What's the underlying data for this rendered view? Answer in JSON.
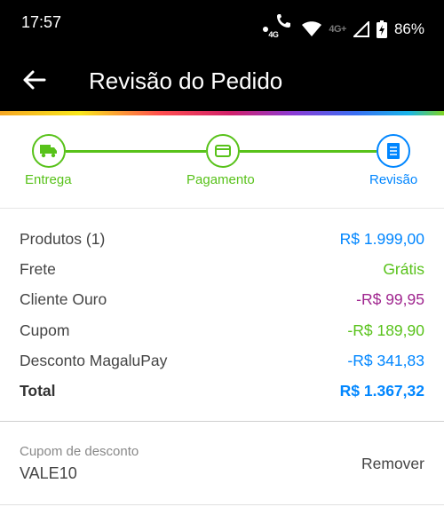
{
  "status_bar": {
    "time": "17:57",
    "net_active": "4G",
    "net_secondary": "4G+",
    "battery": "86%",
    "icons": [
      "dot-icon",
      "wifi-call-icon",
      "wifi-icon",
      "signal-icon",
      "battery-charging-icon"
    ]
  },
  "app_bar": {
    "title": "Revisão do Pedido",
    "back_icon": "arrow-left-icon"
  },
  "stepper": {
    "steps": [
      {
        "label": "Entrega",
        "icon": "truck-icon",
        "state": "done"
      },
      {
        "label": "Pagamento",
        "icon": "credit-card-icon",
        "state": "done"
      },
      {
        "label": "Revisão",
        "icon": "receipt-icon",
        "state": "active"
      }
    ],
    "colors": {
      "done": "#58c21a",
      "active": "#0086ff"
    }
  },
  "summary": {
    "rows": [
      {
        "label": "Produtos (1)",
        "value": "R$ 1.999,00",
        "color": "blue"
      },
      {
        "label": "Frete",
        "value": "Grátis",
        "color": "green"
      },
      {
        "label": "Cliente Ouro",
        "value": "-R$ 99,95",
        "color": "purple"
      },
      {
        "label": "Cupom",
        "value": "-R$ 189,90",
        "color": "green"
      },
      {
        "label": "Desconto MagaluPay",
        "value": "-R$ 341,83",
        "color": "blue"
      }
    ],
    "total": {
      "label": "Total",
      "value": "R$ 1.367,32"
    }
  },
  "coupon": {
    "caption": "Cupom de desconto",
    "code": "VALE10",
    "remove_label": "Remover"
  }
}
